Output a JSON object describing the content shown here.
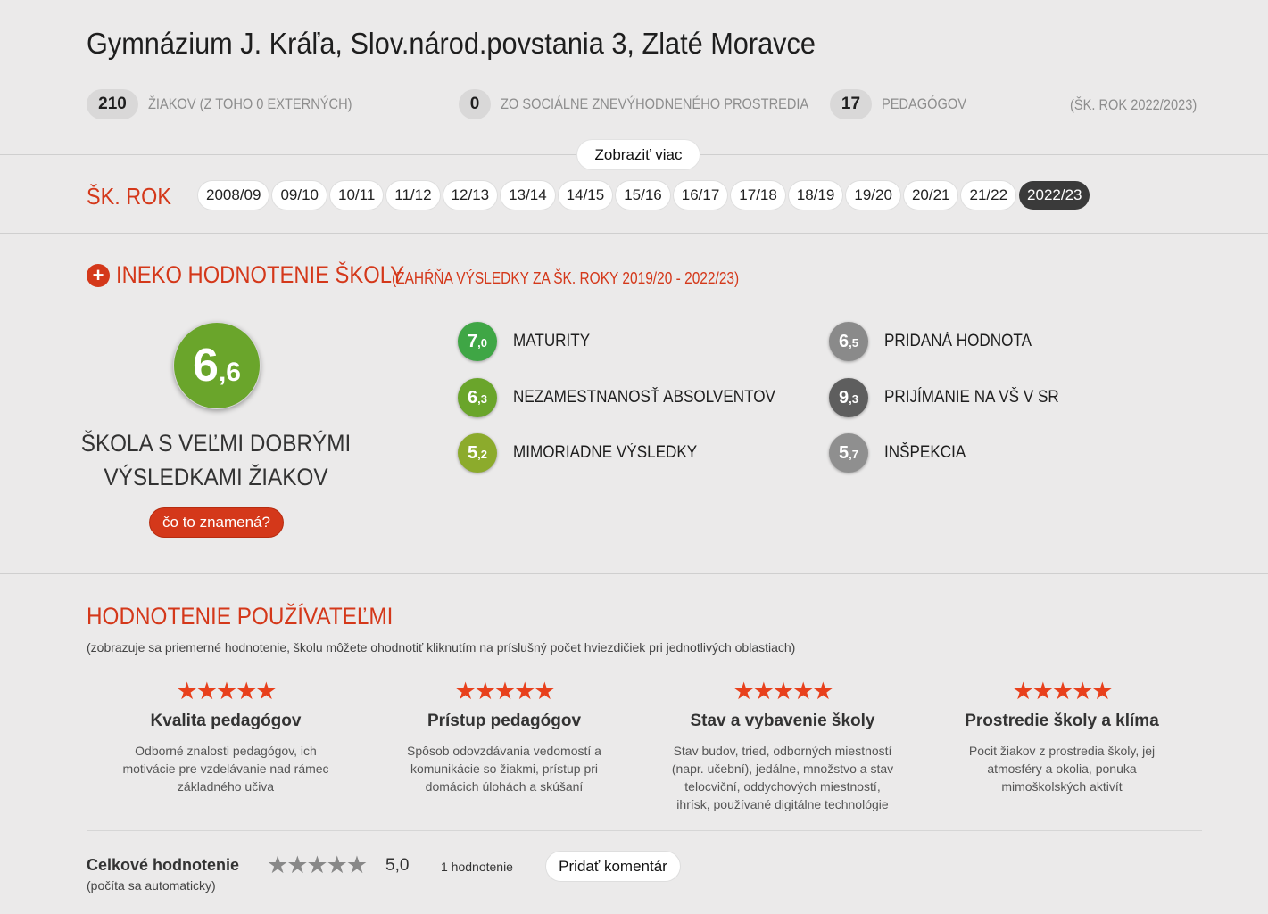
{
  "school": {
    "title": "Gymnázium J. Kráľa, Slov.národ.povstania 3, Zlaté Moravce"
  },
  "stats": {
    "students_num": "210",
    "students_label": "ŽIAKOV (Z TOHO 0 EXTERNÝCH)",
    "disadv_num": "0",
    "disadv_label": "ZO SOCIÁLNE ZNEVÝHODNENÉHO PROSTREDIA",
    "teachers_num": "17",
    "teachers_label": "PEDAGÓGOV",
    "year_note": "(ŠK. ROK 2022/2023)"
  },
  "more_button": "Zobraziť viac",
  "years": {
    "label": "ŠK. ROK",
    "items": [
      "2008/09",
      "09/10",
      "10/11",
      "11/12",
      "12/13",
      "13/14",
      "14/15",
      "15/16",
      "16/17",
      "17/18",
      "18/19",
      "19/20",
      "20/21",
      "21/22",
      "2022/23"
    ],
    "active": "2022/23"
  },
  "ineko": {
    "plus_icon": "+",
    "title": "INEKO HODNOTENIE ŠKOLY",
    "subtitle": "(ZAHŔŇA VÝSLEDKY ZA ŠK. ROKY 2019/20 - 2022/23)",
    "overall_int": "6",
    "overall_dec": ",6",
    "overall_color": "#6aa52b",
    "verdict": "ŠKOLA S VEĽMI DOBRÝMI VÝSLEDKAMI ŽIAKOV",
    "what_button": "čo to znamená?",
    "criteria": [
      {
        "int": "7",
        "dec": ",0",
        "label": "MATURITY",
        "color": "#3fa645"
      },
      {
        "int": "6",
        "dec": ",3",
        "label": "NEZAMESTNANOSŤ ABSOLVENTOV",
        "color": "#6aa52b"
      },
      {
        "int": "5",
        "dec": ",2",
        "label": "MIMORIADNE VÝSLEDKY",
        "color": "#8cab2c"
      },
      {
        "int": "6",
        "dec": ",5",
        "label": "PRIDANÁ HODNOTA",
        "color": "#8a8a8a"
      },
      {
        "int": "9",
        "dec": ",3",
        "label": "PRIJÍMANIE NA VŠ V SR",
        "color": "#5e5e5e"
      },
      {
        "int": "5",
        "dec": ",7",
        "label": "INŠPEKCIA",
        "color": "#8f8f8f"
      }
    ]
  },
  "users": {
    "title": "HODNOTENIE POUŽÍVATEĽMI",
    "note": "(zobrazuje sa priemerné hodnotenie, školu môžete ohodnotiť kliknutím na príslušný počet hviezdičiek pri jednotlivých oblastiach)",
    "star_icon": "★★★★★",
    "categories": [
      {
        "title": "Kvalita pedagógov",
        "desc": "Odborné znalosti pedagógov, ich motivácie pre vzdelávanie nad rámec základného učiva",
        "rating": 5
      },
      {
        "title": "Prístup pedagógov",
        "desc": "Spôsob odovzdávania vedomostí a komunikácie so žiakmi, prístup pri domácich úlohách a skúšaní",
        "rating": 5
      },
      {
        "title": "Stav a vybavenie školy",
        "desc": "Stav budov, tried, odborných miestností (napr. učební), jedálne, množstvo a stav telocviční, oddychových miestností, ihrísk, používané digitálne technológie",
        "rating": 5
      },
      {
        "title": "Prostredie školy a klíma",
        "desc": "Pocit žiakov z prostredia školy, jej atmosféry a okolia, ponuka mimoškolských aktivít",
        "rating": 5
      }
    ],
    "total_label": "Celkové hodnotenie",
    "total_sub": "(počíta sa automaticky)",
    "total_value": "5,0",
    "count": "1 hodnotenie",
    "add_button": "Pridať komentár"
  }
}
